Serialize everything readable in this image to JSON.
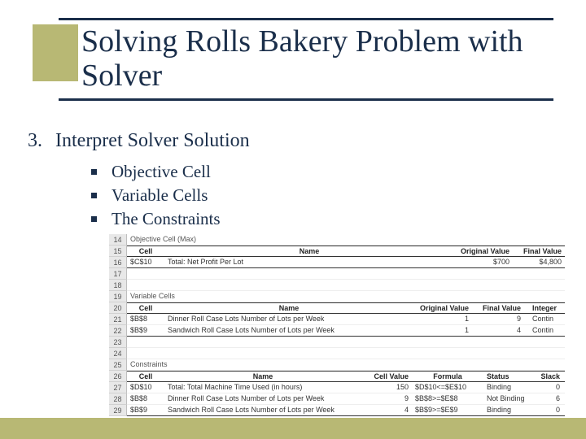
{
  "title": "Solving Rolls Bakery Problem with Solver",
  "step": {
    "num": "3.",
    "text": "Interpret Solver Solution"
  },
  "bullets": [
    "Objective Cell",
    "Variable Cells",
    "The Constraints"
  ],
  "rownums": [
    "14",
    "15",
    "16",
    "17",
    "18",
    "19",
    "20",
    "21",
    "22",
    "23",
    "24",
    "25",
    "26",
    "27",
    "28",
    "29"
  ],
  "sections": {
    "obj": {
      "label": "Objective Cell (Max)",
      "headers": [
        "Cell",
        "Name",
        "Original Value",
        "Final Value"
      ],
      "row": {
        "cell": "$C$10",
        "name": "Total: Net Profit Per Lot",
        "ov": "$700",
        "fv": "$4,800"
      }
    },
    "var": {
      "label": "Variable Cells",
      "headers": [
        "Cell",
        "Name",
        "Original Value",
        "Final Value",
        "Integer"
      ],
      "rows": [
        {
          "cell": "$B$8",
          "name": "Dinner Roll Case Lots Number of Lots per Week",
          "ov": "1",
          "fv": "9",
          "int": "Contin"
        },
        {
          "cell": "$B$9",
          "name": "Sandwich Roll Case Lots Number of Lots per Week",
          "ov": "1",
          "fv": "4",
          "int": "Contin"
        }
      ]
    },
    "con": {
      "label": "Constraints",
      "headers": [
        "Cell",
        "Name",
        "Cell Value",
        "Formula",
        "Status",
        "Slack"
      ],
      "rows": [
        {
          "cell": "$D$10",
          "name": "Total: Total Machine Time Used (in hours)",
          "cv": "150",
          "form": "$D$10<=$E$10",
          "stat": "Binding",
          "slk": "0"
        },
        {
          "cell": "$B$8",
          "name": "Dinner Roll Case Lots Number of Lots per Week",
          "cv": "9",
          "form": "$B$8>=$E$8",
          "stat": "Not Binding",
          "slk": "6"
        },
        {
          "cell": "$B$9",
          "name": "Sandwich Roll Case Lots Number of Lots per Week",
          "cv": "4",
          "form": "$B$9>=$E$9",
          "stat": "Binding",
          "slk": "0"
        }
      ]
    }
  }
}
